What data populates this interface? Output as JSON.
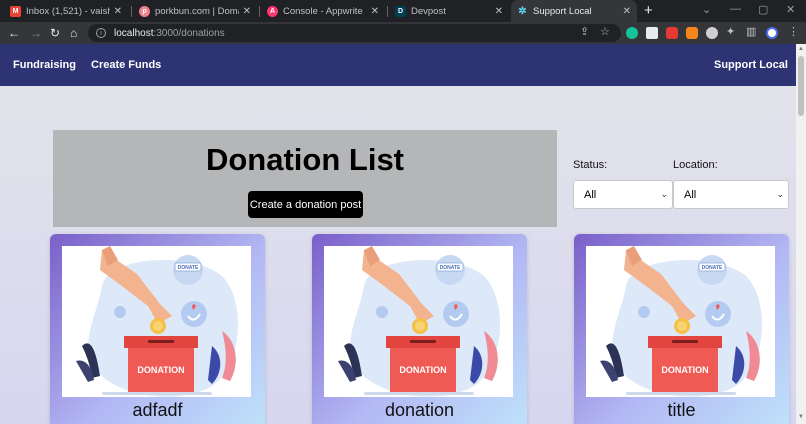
{
  "browser": {
    "tabs": [
      {
        "title": "Inbox (1,521) - vaishnavi.t",
        "icon_color": "#ea4335",
        "icon_char": "M"
      },
      {
        "title": "porkbun.com | Domain M",
        "icon_color": "#ef7f8d",
        "icon_char": "p"
      },
      {
        "title": "Console - Appwrite",
        "icon_color": "#fd366e",
        "icon_char": "A"
      },
      {
        "title": "Devpost",
        "icon_color": "#003e54",
        "icon_char": "D"
      },
      {
        "title": "Support Local",
        "icon_color": "#5f6368",
        "icon_char": "✲"
      }
    ],
    "url_host": "localhost",
    "url_path": ":3000/donations"
  },
  "navbar": {
    "brand": "Fundraising",
    "create_funds": "Create Funds",
    "support_local": "Support Local"
  },
  "hero": {
    "title": "Donation List",
    "create_button": "Create a donation post"
  },
  "filters": {
    "status_label": "Status:",
    "status_value": "All",
    "location_label": "Location:",
    "location_value": "All"
  },
  "cards": [
    {
      "title": "adfadf",
      "image_label": "DONATION",
      "bubble_label": "DONATE"
    },
    {
      "title": "donation",
      "image_label": "DONATION",
      "bubble_label": "DONATE"
    },
    {
      "title": "title",
      "image_label": "DONATION",
      "bubble_label": "DONATE"
    }
  ],
  "colors": {
    "navbar": "#2e3374",
    "hero_bg": "#b4b6b8",
    "button_bg": "#000000",
    "card_gradient_start": "#7a5fc9",
    "card_gradient_end": "#bfe3fa",
    "donation_box": "#ef5a54"
  }
}
